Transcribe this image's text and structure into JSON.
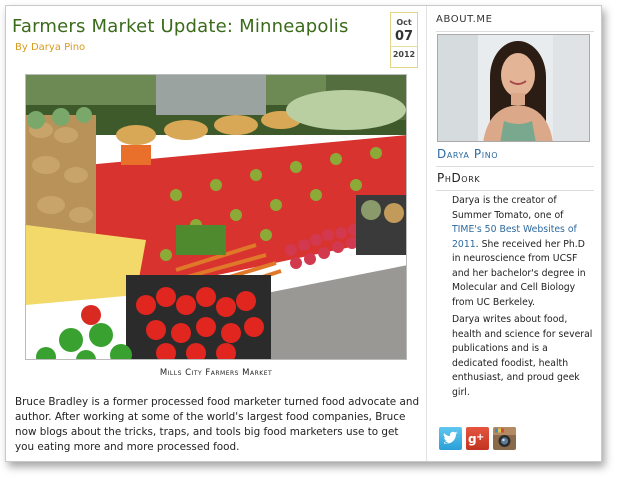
{
  "post": {
    "title": "Farmers Market Update: Minneapolis",
    "byline": "By Darya Pino",
    "date": {
      "month": "Oct",
      "day": "07",
      "year": "2012"
    },
    "photo_caption": "Mills City Farmers Market",
    "body": "Bruce Bradley is a former processed food marketer turned food advocate and author. After working at some of the world's largest food companies, Bruce now blogs about the tricks, traps, and tools big food marketers use to get you eating more and more processed food."
  },
  "sidebar": {
    "section_title": "ABOUT.ME",
    "author_name": "Darya Pino",
    "author_role": "PhDork",
    "bio": {
      "p1_pre": "Darya is the creator of Summer Tomato, one of ",
      "p1_link": "TIME's 50 Best Websites of 2011",
      "p1_post": ". She received her Ph.D in neuroscience from UCSF and her bachelor's degree in Molecular and Cell Biology from UC Berkeley.",
      "p2": "Darya writes about food, health and science for several publications and is a dedicated foodist, health enthusiast, and proud geek girl."
    },
    "social_icons": [
      "twitter-icon",
      "google-plus-icon",
      "instagram-icon"
    ]
  },
  "colors": {
    "title": "#3a6b1a",
    "byline": "#d99a1e",
    "link": "#2d6a9f"
  }
}
